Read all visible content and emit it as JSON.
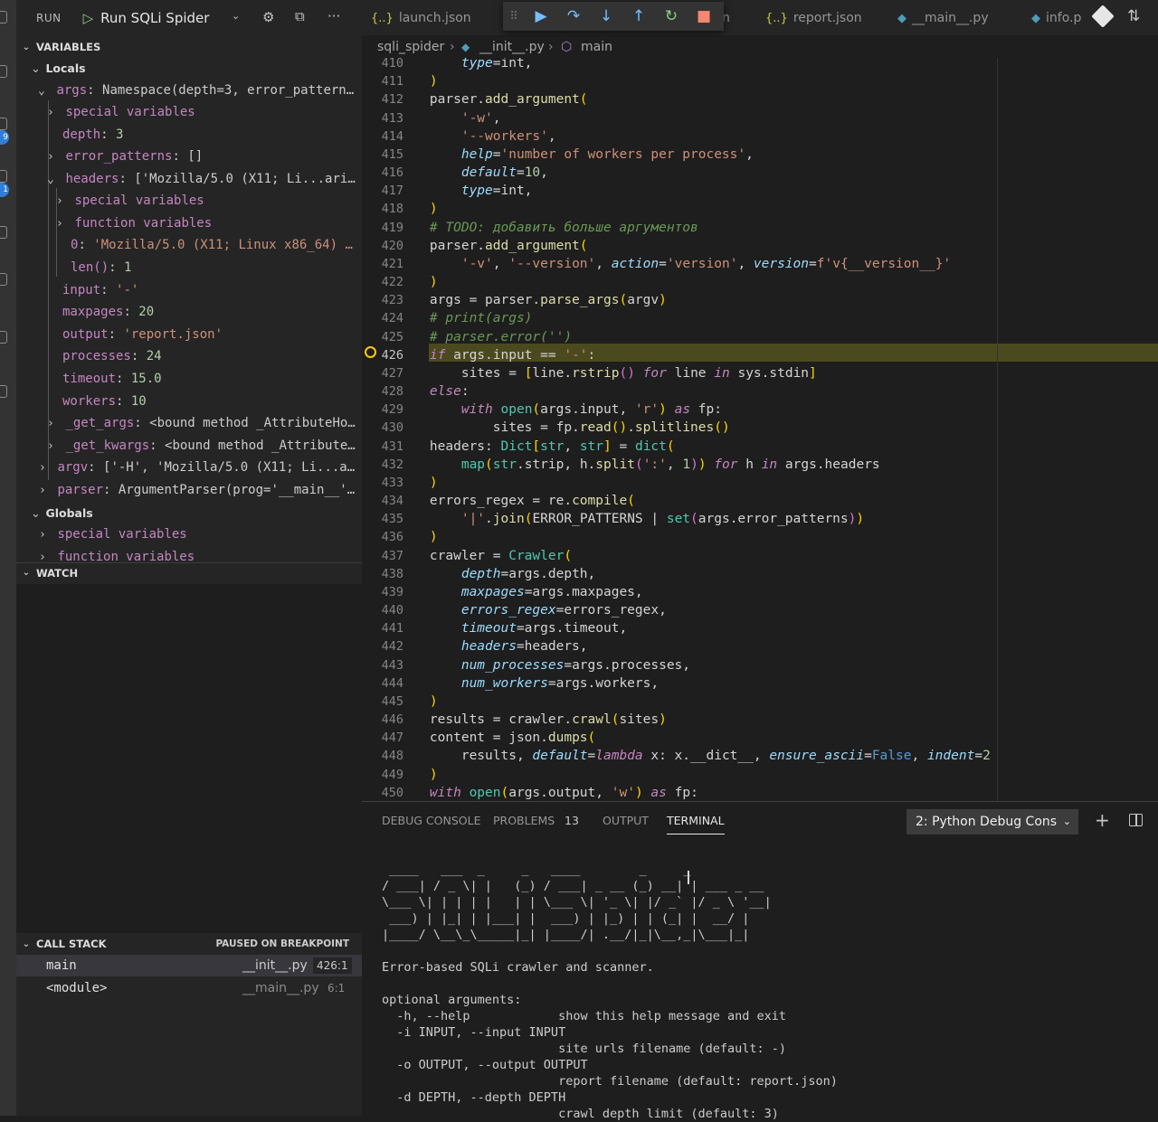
{
  "run_bar": {
    "run_label": "RUN",
    "config_name": "Run SQLi Spider"
  },
  "activity_bar": {
    "badges": [
      "9",
      "1"
    ]
  },
  "variables": {
    "title": "VARIABLES",
    "locals_label": "Locals",
    "globals_label": "Globals",
    "rows": [
      {
        "name": "args",
        "value": "Namespace(depth=3, error_pattern…"
      },
      {
        "name": "special variables",
        "value": ""
      },
      {
        "name": "depth",
        "value": "3"
      },
      {
        "name": "error_patterns",
        "value": "[]"
      },
      {
        "name": "headers",
        "value": "['Mozilla/5.0 (X11; Li...ari…"
      },
      {
        "name": "special variables",
        "value": ""
      },
      {
        "name": "function variables",
        "value": ""
      },
      {
        "name": "0",
        "value": "'Mozilla/5.0 (X11; Linux x86_64) …"
      },
      {
        "name": "len()",
        "value": "1"
      },
      {
        "name": "input",
        "value": "'-'"
      },
      {
        "name": "maxpages",
        "value": "20"
      },
      {
        "name": "output",
        "value": "'report.json'"
      },
      {
        "name": "processes",
        "value": "24"
      },
      {
        "name": "timeout",
        "value": "15.0"
      },
      {
        "name": "workers",
        "value": "10"
      },
      {
        "name": "_get_args",
        "value": "<bound method _AttributeHo…"
      },
      {
        "name": "_get_kwargs",
        "value": "<bound method _Attribute…"
      },
      {
        "name": "argv",
        "value": "['-H', 'Mozilla/5.0 (X11; Li...a…"
      },
      {
        "name": "parser",
        "value": "ArgumentParser(prog='__main__'…"
      },
      {
        "name": "special variables",
        "value": ""
      },
      {
        "name": "function variables",
        "value": ""
      }
    ]
  },
  "watch": {
    "title": "WATCH"
  },
  "call_stack": {
    "title": "CALL STACK",
    "status": "PAUSED ON BREAKPOINT",
    "frames": [
      {
        "name": "main",
        "file": "__init__.py",
        "pos": "426:1"
      },
      {
        "name": "<module>",
        "file": "__main__.py",
        "pos": "6:1"
      }
    ]
  },
  "tabs": [
    {
      "label": "launch.json",
      "icon": "{..}"
    },
    {
      "label": "n",
      "icon": ""
    },
    {
      "label": "report.json",
      "icon": "{..}"
    },
    {
      "label": "__main__.py",
      "icon": "python"
    },
    {
      "label": "info.p",
      "icon": "python"
    }
  ],
  "breadcrumb": {
    "folder": "sqli_spider",
    "file": "__init__.py",
    "symbol": "main"
  },
  "editor": {
    "current_line": 426,
    "line_numbers": [
      "410",
      "411",
      "412",
      "413",
      "414",
      "415",
      "416",
      "417",
      "418",
      "419",
      "420",
      "421",
      "422",
      "423",
      "424",
      "425",
      "426",
      "427",
      "428",
      "429",
      "430",
      "431",
      "432",
      "433",
      "434",
      "435",
      "436",
      "437",
      "438",
      "439",
      "440",
      "441",
      "442",
      "443",
      "444",
      "445",
      "446",
      "447",
      "448",
      "449",
      "450"
    ],
    "lines": [
      "        type=int,",
      "    )",
      "    parser.add_argument(",
      "        '-w',",
      "        '--workers',",
      "        help='number of workers per process',",
      "        default=10,",
      "        type=int,",
      "    )",
      "    # TODO: добавить больше аргументов",
      "    parser.add_argument(",
      "        '-v', '--version', action='version', version=f'v{__version__}'",
      "    )",
      "    args = parser.parse_args(argv)",
      "    # print(args)",
      "    # parser.error('')",
      "    if args.input == '-':",
      "        sites = [line.rstrip() for line in sys.stdin]",
      "    else:",
      "        with open(args.input, 'r') as fp:",
      "            sites = fp.read().splitlines()",
      "    headers: Dict[str, str] = dict(",
      "        map(str.strip, h.split(':', 1)) for h in args.headers",
      "    )",
      "    errors_regex = re.compile(",
      "        '|'.join(ERROR_PATTERNS | set(args.error_patterns))",
      "    )",
      "    crawler = Crawler(",
      "        depth=args.depth,",
      "        maxpages=args.maxpages,",
      "        errors_regex=errors_regex,",
      "        timeout=args.timeout,",
      "        headers=headers,",
      "        num_processes=args.processes,",
      "        num_workers=args.workers,",
      "    )",
      "    results = crawler.crawl(sites)",
      "    content = json.dumps(",
      "        results, default=lambda x: x.__dict__, ensure_ascii=False, indent=2",
      "    )",
      "    with open(args.output, 'w') as fp:"
    ]
  },
  "panel": {
    "tabs": [
      "DEBUG CONSOLE",
      "PROBLEMS",
      "OUTPUT",
      "TERMINAL"
    ],
    "problems_count": "13",
    "active_tab": "TERMINAL",
    "terminal_select": "2: Python Debug Cons",
    "terminal_lines": [
      " ____   ___  _     _   ____        _     _           ",
      "/ ___| / _ \\| |   (_) / ___| _ __ (_) __| | ___ _ __ ",
      "\\___ \\| | | | |   | | \\___ \\| '_ \\| |/ _` |/ _ \\ '__|",
      " ___) | |_| | |___| |  ___) | |_) | | (_| |  __/ |   ",
      "|____/ \\__\\_\\_____|_| |____/| .__/|_|\\__,_|\\___|_|   ",
      "",
      "Error-based SQLi crawler and scanner.",
      "",
      "optional arguments:",
      "  -h, --help            show this help message and exit",
      "  -i INPUT, --input INPUT",
      "                        site urls filename (default: -)",
      "  -o OUTPUT, --output OUTPUT",
      "                        report filename (default: report.json)",
      "  -d DEPTH, --depth DEPTH",
      "                        crawl depth limit (default: 3)"
    ]
  },
  "colors": {
    "sidebar_bg": "#252526",
    "editor_bg": "#1e1e1e",
    "current_line_bg": "#4b4a1f",
    "breakpoint": "#ffcc00",
    "debug_toolbar_bg": "#333333"
  }
}
